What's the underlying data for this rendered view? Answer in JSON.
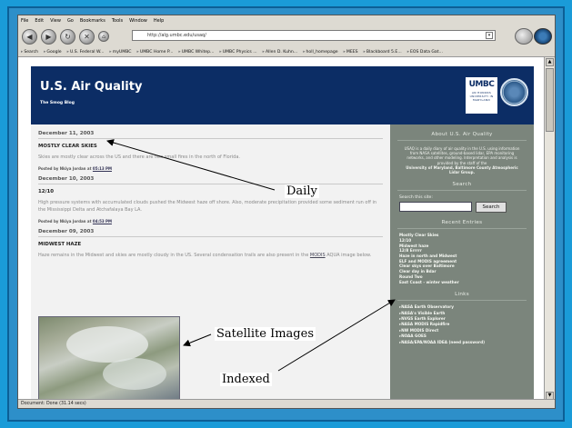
{
  "menubar": {
    "items": [
      "File",
      "Edit",
      "View",
      "Go",
      "Bookmarks",
      "Tools",
      "Window",
      "Help"
    ]
  },
  "navbar": {
    "url": "http://alg.umbc.edu/usaq/",
    "buttons": [
      "back-icon",
      "forward-icon",
      "reload-icon",
      "stop-icon",
      "home-icon",
      "search-icon",
      "throbber-icon"
    ]
  },
  "bookmarks": [
    "Search",
    "Google",
    "U.S. Federal W...",
    "myUMBC",
    "UMBC Home P...",
    "UMBC Whitep...",
    "UMBC Physics ...",
    "Allen D. Kuhn...",
    "holl_homepage",
    "MEES",
    "Blackboard 5.E...",
    "EOS Data Gat..."
  ],
  "blog": {
    "title": "U.S. Air Quality",
    "subtitle": "The Smog Blog",
    "logo": {
      "main": "UMBC",
      "sub": "AN HONORS UNIVERSITY IN MARYLAND"
    }
  },
  "posts": [
    {
      "date": "December 11, 2003",
      "title": "MOSTLY CLEAR SKIES",
      "body": "Skies are mostly clear across the US and there are two small fires in the north of Florida.",
      "meta_prefix": "Posted by Nkiya Jordan at",
      "time": "05:13 PM"
    },
    {
      "date": "December 10, 2003",
      "title": "12/10",
      "body": "High pressure systems with accumulated clouds pushed the Midwest haze off shore. Also, moderate precipitation provided some sediment run off in the Mississippi Delta and Atchafalaya Bay LA.",
      "meta_prefix": "Posted by Nkiya Jordan at",
      "time": "04:53 PM"
    },
    {
      "date": "December 09, 2003",
      "title": "MIDWEST HAZE",
      "body_start": "Haze remains in the Midwest and skies are mostly cloudy in the US. Several condensation trails are also present in the",
      "body_link": "MODIS",
      "body_end": "AQUA image below."
    }
  ],
  "sidebar": {
    "about_heading": "About U.S. Air Quality",
    "about_text": "USAQ is a daily diary of air quality in the U.S. using information from NASA satellites, ground-based lidar, EPA monitoring networks, and other modeling. Interpretation and analysis is provided by the staff of the",
    "about_org": "University of Maryland, Baltimore County Atmospheric Lidar Group.",
    "search_heading": "Search",
    "search_label": "Search this site:",
    "search_button": "Search",
    "recent_heading": "Recent Entries",
    "recent_entries": [
      "Mostly Clear Skies",
      "12/10",
      "Midwest haze",
      "12/8 Errrrr",
      "Haze in north and Midwest",
      "ELF and MODIS agreement",
      "Clear skys over Baltimore",
      "Clear day in Bdar",
      "Round Two",
      "East Coast - winter weather"
    ],
    "links_heading": "Links",
    "links": [
      "NASA Earth Observatory",
      "NASA's Visible Earth",
      "NVGS Earth Explorer",
      "NASA MODIS Rapidfire",
      "NW MODIS Direct",
      "NOAA GOES",
      "NASA/EPA/NOAA IDEA (need password)"
    ]
  },
  "status": "Document: Done (31.14 secs)",
  "annotations": {
    "daily": "Daily",
    "satellite": "Satellite Images",
    "indexed": "Indexed"
  }
}
